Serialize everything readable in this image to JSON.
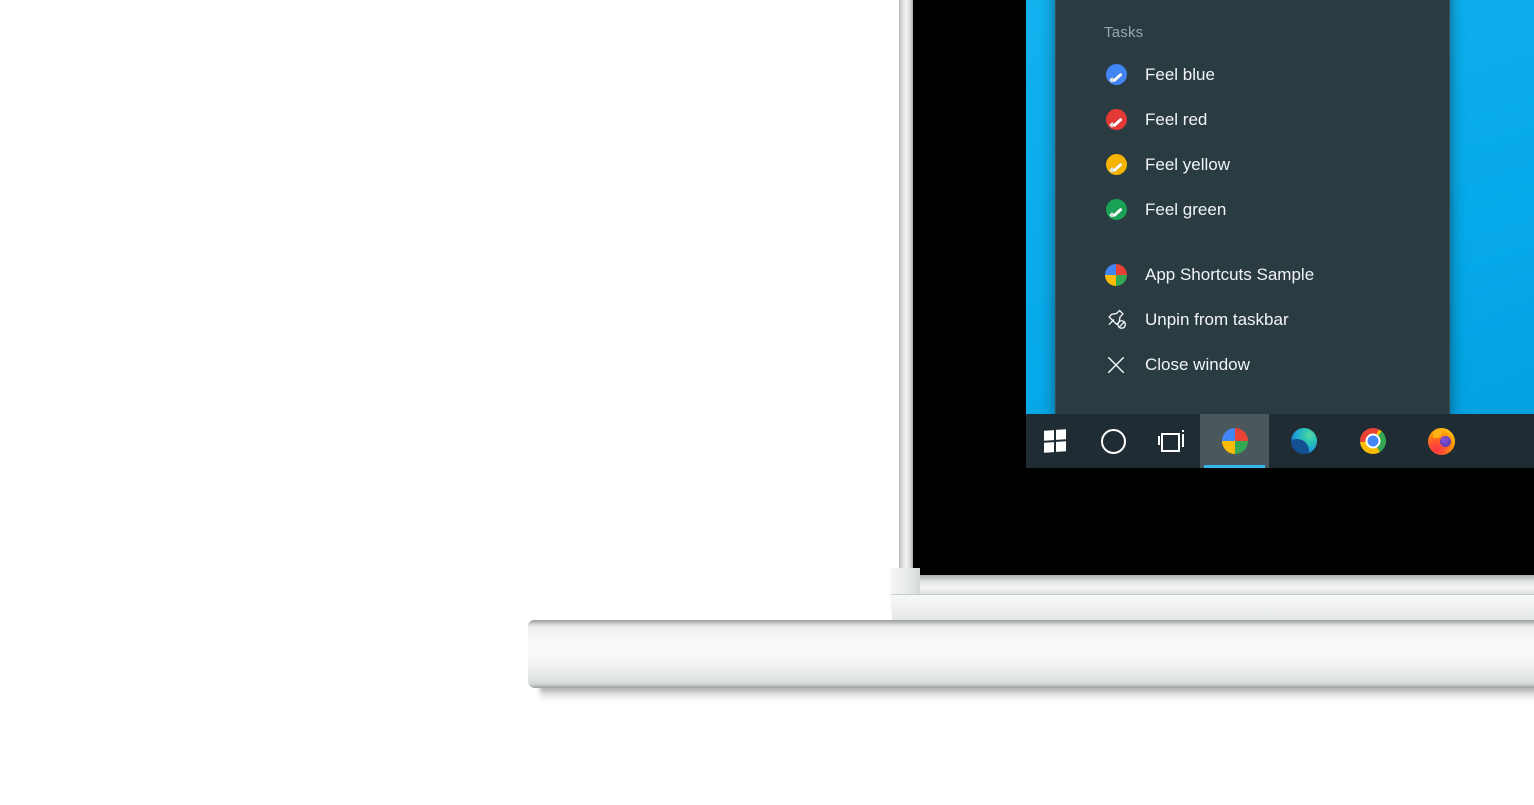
{
  "scene": {
    "device": "laptop",
    "description": "Windows 10 desktop on a white laptop showing a taskbar jump list"
  },
  "colors": {
    "wallpaper_cyan": "#0caceb",
    "jumplist_bg": "#2a3b42",
    "taskbar_bg": "#1f2c33",
    "accent_underline": "#35b6f0",
    "header_text": "#99a6ac",
    "item_text": "#f2f4f5",
    "active_item_bg": "#4a585e"
  },
  "jumplist": {
    "header": "Tasks",
    "tasks": [
      {
        "label": "Feel blue",
        "icon": "paint-blue-icon",
        "color": "#4285f4"
      },
      {
        "label": "Feel red",
        "icon": "paint-red-icon",
        "color": "#e53935"
      },
      {
        "label": "Feel yellow",
        "icon": "paint-yellow-icon",
        "color": "#f4b400"
      },
      {
        "label": "Feel green",
        "icon": "paint-green-icon",
        "color": "#1aa356"
      }
    ],
    "actions": [
      {
        "label": "App Shortcuts Sample",
        "icon": "app-pie-icon"
      },
      {
        "label": "Unpin from taskbar",
        "icon": "unpin-icon"
      },
      {
        "label": "Close window",
        "icon": "close-x-icon"
      }
    ]
  },
  "taskbar": {
    "buttons": [
      {
        "name": "start-button",
        "icon": "windows-logo-icon",
        "label": "Start",
        "active": false
      },
      {
        "name": "cortana-button",
        "icon": "cortana-ring-icon",
        "label": "Cortana",
        "active": false
      },
      {
        "name": "task-view-button",
        "icon": "task-view-icon",
        "label": "Task View",
        "active": false
      },
      {
        "name": "app-shortcuts-sample-button",
        "icon": "app-pie-icon",
        "label": "App Shortcuts Sample",
        "active": true
      },
      {
        "name": "edge-button",
        "icon": "edge-icon",
        "label": "Microsoft Edge",
        "active": false
      },
      {
        "name": "chrome-button",
        "icon": "chrome-icon",
        "label": "Google Chrome",
        "active": false
      },
      {
        "name": "firefox-button",
        "icon": "firefox-icon",
        "label": "Mozilla Firefox",
        "active": false
      }
    ]
  }
}
